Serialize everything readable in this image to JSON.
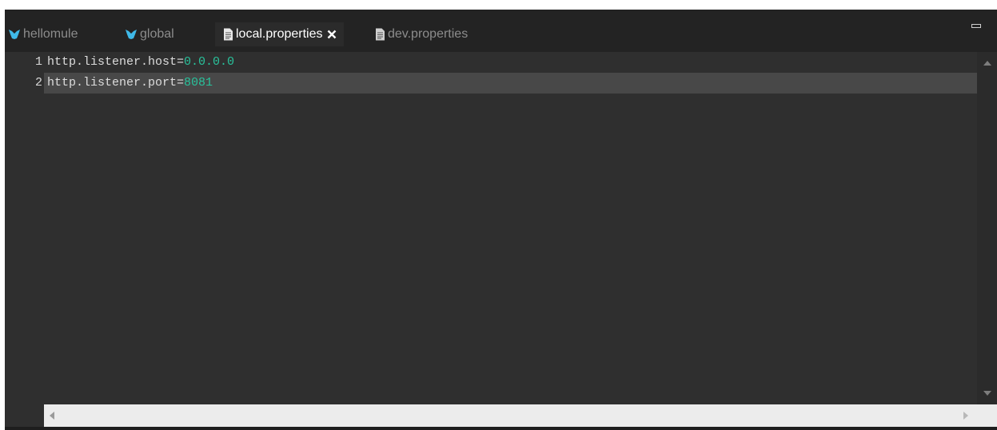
{
  "tabs": [
    {
      "label": "hellomule",
      "icon": "mule-icon",
      "active": false
    },
    {
      "label": "global",
      "icon": "mule-icon",
      "active": false
    },
    {
      "label": "local.properties",
      "icon": "file-icon",
      "active": true,
      "closable": true
    },
    {
      "label": "dev.properties",
      "icon": "file-icon",
      "active": false
    }
  ],
  "editor": {
    "lines": [
      {
        "number": "1",
        "key": "http.listener.host",
        "eq": "=",
        "value": "0.0.0.0"
      },
      {
        "number": "2",
        "key": "http.listener.port",
        "eq": "=",
        "value": "8081"
      }
    ],
    "current_line": 2
  },
  "colors": {
    "tab_bar": "#232323",
    "editor_bg": "#2f2f2f",
    "current_line": "#484848",
    "value": "#29c19b",
    "mule_icon": "#3fb9e8"
  }
}
